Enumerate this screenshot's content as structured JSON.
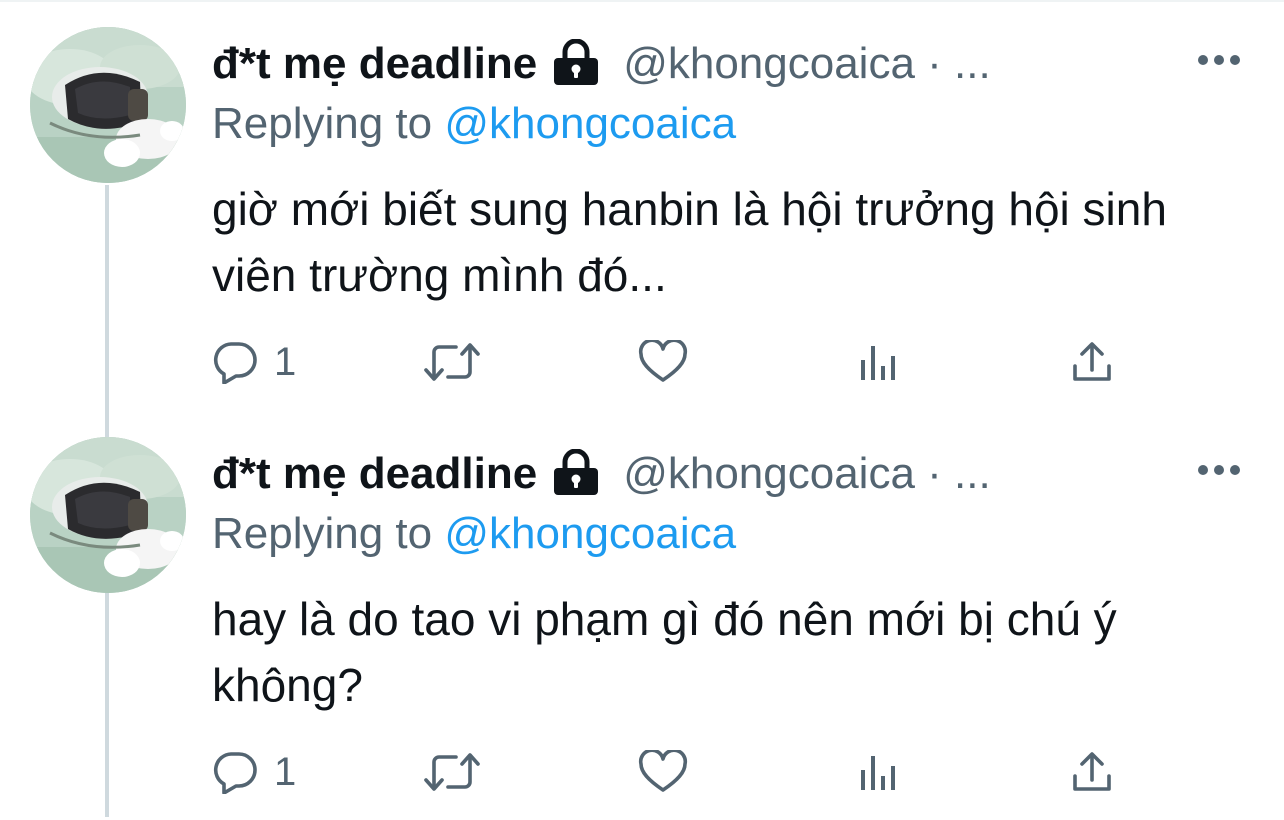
{
  "tweets": [
    {
      "display_name": "đ*t mẹ deadline",
      "handle": "@khongcoaica · ...",
      "replying_prefix": "Replying to",
      "replying_to": "@khongcoaica",
      "text": "giờ mới biết sung hanbin là hội trưởng hội sinh viên trường mình đó...",
      "reply_count": "1"
    },
    {
      "display_name": "đ*t mẹ deadline",
      "handle": "@khongcoaica · ...",
      "replying_prefix": "Replying to",
      "replying_to": "@khongcoaica",
      "text": "hay là do tao vi phạm gì đó nên mới bị chú ý không?",
      "reply_count": "1"
    }
  ],
  "icons": {
    "protected": "lock-icon",
    "more": "more-dots-icon",
    "reply": "reply-bubble-icon",
    "retweet": "retweet-icon",
    "like": "heart-icon",
    "views": "views-bars-icon",
    "share": "share-upload-icon"
  },
  "colors": {
    "text": "#0f1419",
    "secondary": "#536471",
    "link": "#1d9bf0",
    "thread_line": "#cfd9de"
  }
}
